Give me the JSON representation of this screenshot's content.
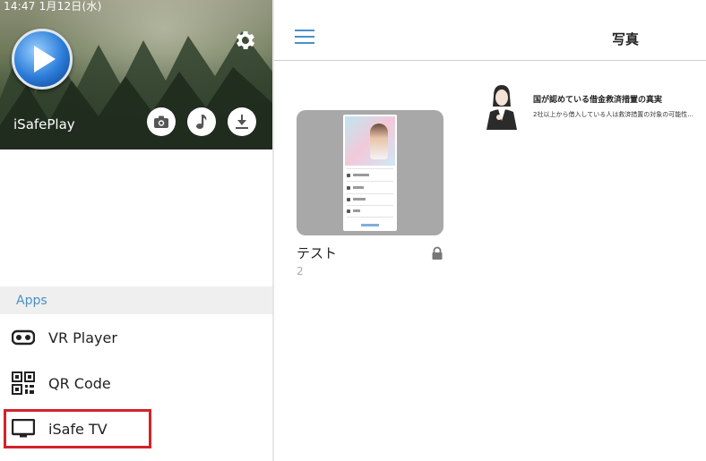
{
  "status_bar": {
    "time": "14:47   1月12日(水)"
  },
  "app": {
    "name": "iSafePlay"
  },
  "sidebar": {
    "section_header": "Apps",
    "items": [
      {
        "label": "VR Player",
        "icon": "vr-headset-icon"
      },
      {
        "label": "QR Code",
        "icon": "qr-code-icon"
      },
      {
        "label": "iSafe TV",
        "icon": "tv-monitor-icon"
      }
    ],
    "actions": [
      {
        "icon": "camera-icon"
      },
      {
        "icon": "music-note-icon"
      },
      {
        "icon": "download-icon"
      }
    ]
  },
  "header": {
    "title": "写真"
  },
  "album": {
    "name": "テスト",
    "count": "2",
    "locked": true
  },
  "ad": {
    "title": "国が認めている借金救済措置の真実",
    "text": "2社以上から借入している人は救済措置の対象の可能性..."
  },
  "colors": {
    "accent": "#4a90c8",
    "highlight": "#d2232a"
  }
}
